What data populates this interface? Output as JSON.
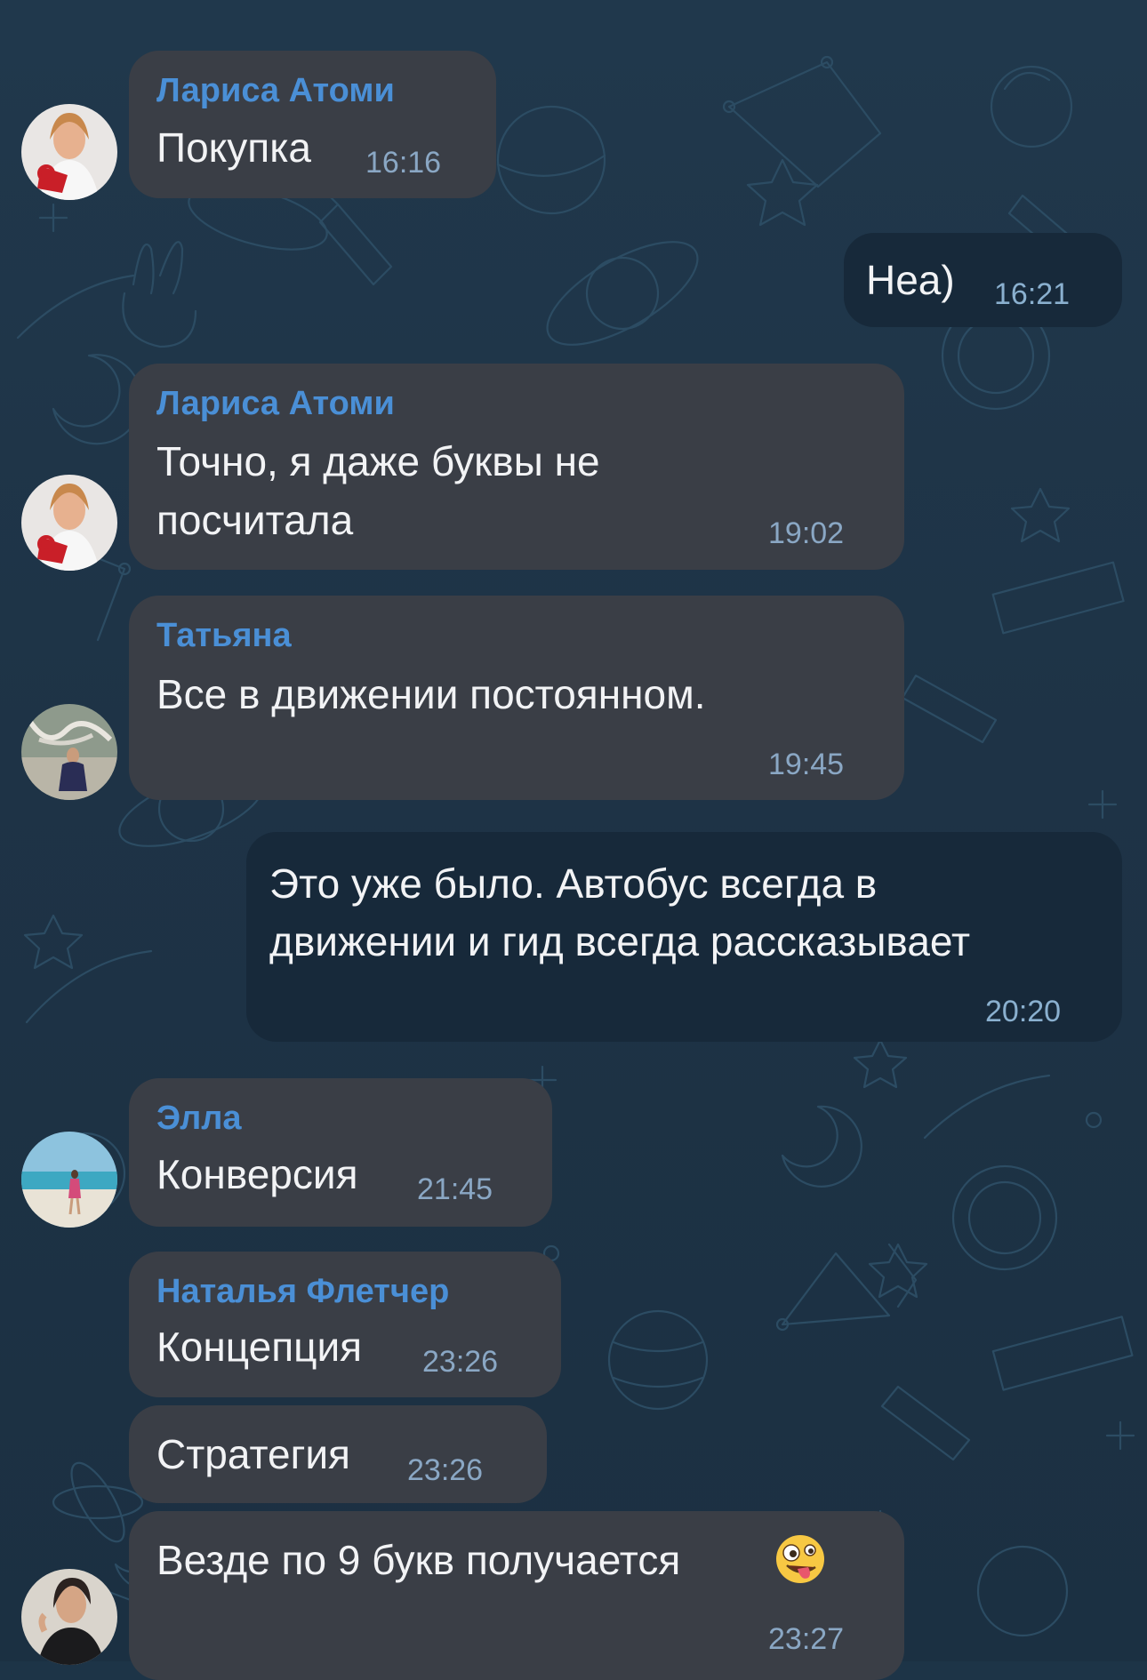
{
  "chat": {
    "messages": [
      {
        "direction": "in",
        "sender": "Лариса Атоми",
        "text": "Покупка",
        "time": "16:16"
      },
      {
        "direction": "out",
        "text": "Неа)",
        "time": "16:21"
      },
      {
        "direction": "in",
        "sender": "Лариса Атоми",
        "text_line1": "Точно, я даже буквы не",
        "text_line2": "посчитала",
        "time": "19:02"
      },
      {
        "direction": "in",
        "sender": "Татьяна",
        "text": "Все в движении постоянном.",
        "time": "19:45"
      },
      {
        "direction": "out",
        "text_line1": "Это уже было. Автобус всегда в",
        "text_line2": "движении и гид всегда рассказывает",
        "time": "20:20"
      },
      {
        "direction": "in",
        "sender": "Элла",
        "text": "Конверсия",
        "time": "21:45"
      },
      {
        "direction": "in",
        "sender": "Наталья Флетчер",
        "text": "Концепция",
        "time": "23:26"
      },
      {
        "direction": "in",
        "text": "Стратегия",
        "time": "23:26"
      },
      {
        "direction": "in",
        "text": "Везде по 9 букв получается",
        "emoji": "zany-face-emoji",
        "time": "23:27"
      }
    ]
  },
  "colors": {
    "background": "#1d3447",
    "incoming_bubble": "#3a3e46",
    "outgoing_bubble": "#17293a",
    "sender_name": "#4a8fd6",
    "timestamp": "#8aa7c4"
  }
}
